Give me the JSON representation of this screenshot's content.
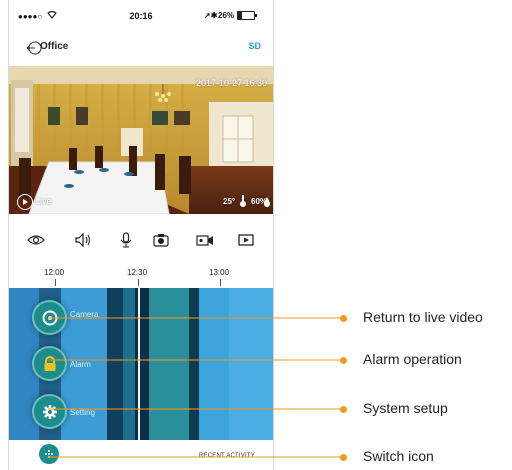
{
  "status_bar": {
    "signal": "●●●●○",
    "time": "20:16",
    "battery": "26%",
    "battery_level": 0.26
  },
  "nav": {
    "title": "Office",
    "sd_label": "SD"
  },
  "video": {
    "timestamp": "2017-10-27 16:30",
    "live_label": "Live",
    "temperature": "25°",
    "humidity": "60%"
  },
  "toolbar": {
    "icons": [
      "eye-icon",
      "speaker-icon",
      "microphone-icon",
      "snapshot-icon",
      "record-icon",
      "playback-icon"
    ]
  },
  "timeline": {
    "ticks": [
      "12:00",
      "12:30",
      "13:00"
    ]
  },
  "menu": {
    "camera_label": "Camera",
    "alarm_label": "Alarm",
    "setting_label": "Setting"
  },
  "bottom": {
    "recent_label": "RECENT ACTIVITY"
  },
  "callouts": {
    "live": "Return to live video",
    "alarm": "Alarm operation",
    "setup": "System setup",
    "switch": "Switch icon"
  },
  "colors": {
    "accent": "#1e9fe0",
    "teal": "#1d8c8d",
    "callout_line": "#f39a1e"
  }
}
